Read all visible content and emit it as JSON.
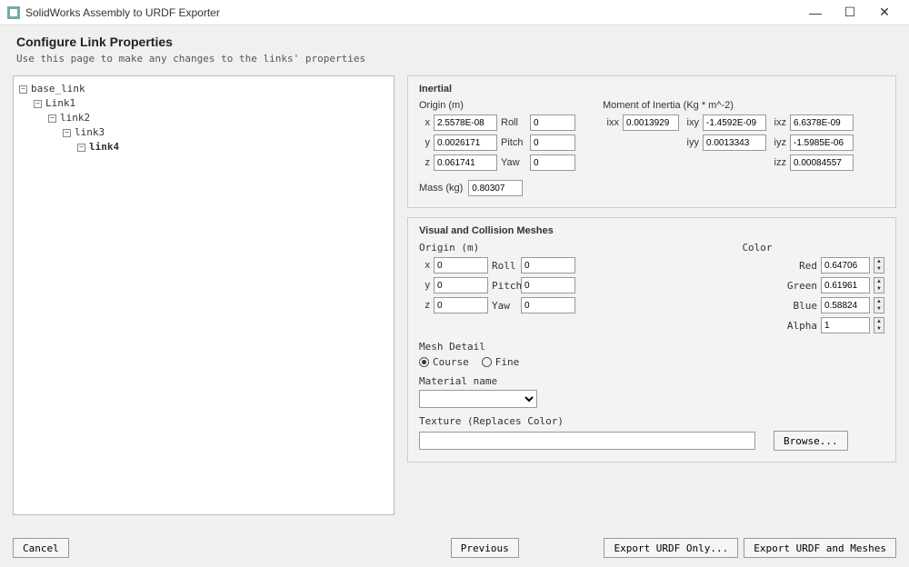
{
  "titlebar": {
    "title": "SolidWorks Assembly to URDF Exporter"
  },
  "header": {
    "title": "Configure Link Properties",
    "subtitle": "Use this page to make any changes to the links' properties"
  },
  "tree": {
    "nodes": [
      {
        "label": "base_link",
        "depth": 0,
        "expanded": true
      },
      {
        "label": "Link1",
        "depth": 1,
        "expanded": true
      },
      {
        "label": "link2",
        "depth": 2,
        "expanded": true
      },
      {
        "label": "link3",
        "depth": 3,
        "expanded": true
      },
      {
        "label": "link4",
        "depth": 4,
        "expanded": true,
        "bold": true
      }
    ]
  },
  "inertial": {
    "title": "Inertial",
    "origin_label": "Origin (m)",
    "moment_label": "Moment of Inertia (Kg * m^-2)",
    "x_label": "x",
    "x": "2.5578E-08",
    "y_label": "y",
    "y": "0.0026171",
    "z_label": "z",
    "z": "0.061741",
    "roll_label": "Roll",
    "roll": "0",
    "pitch_label": "Pitch",
    "pitch": "0",
    "yaw_label": "Yaw",
    "yaw": "0",
    "ixx_label": "ixx",
    "ixx": "0.0013929",
    "ixy_label": "ixy",
    "ixy": "-1.4592E-09",
    "ixz_label": "ixz",
    "ixz": "6.6378E-09",
    "iyy_label": "iyy",
    "iyy": "0.0013343",
    "iyz_label": "iyz",
    "iyz": "-1.5985E-06",
    "izz_label": "izz",
    "izz": "0.00084557",
    "mass_label": "Mass (kg)",
    "mass": "0.80307"
  },
  "visual": {
    "title": "Visual and Collision Meshes",
    "origin_label": "Origin (m)",
    "x_label": "x",
    "x": "0",
    "y_label": "y",
    "y": "0",
    "z_label": "z",
    "z": "0",
    "roll_label": "Roll",
    "roll": "0",
    "pitch_label": "Pitch",
    "pitch": "0",
    "yaw_label": "Yaw",
    "yaw": "0",
    "color_label": "Color",
    "red_label": "Red",
    "red": "0.64706",
    "green_label": "Green",
    "green": "0.61961",
    "blue_label": "Blue",
    "blue": "0.58824",
    "alpha_label": "Alpha",
    "alpha": "1",
    "mesh_detail_label": "Mesh Detail",
    "course_label": "Course",
    "fine_label": "Fine",
    "mesh_detail_selected": "course",
    "material_label": "Material name",
    "material_value": "",
    "texture_label": "Texture (Replaces Color)",
    "texture_value": "",
    "browse_label": "Browse..."
  },
  "footer": {
    "cancel": "Cancel",
    "previous": "Previous",
    "export_urdf": "Export URDF Only...",
    "export_urdf_meshes": "Export URDF and Meshes"
  }
}
